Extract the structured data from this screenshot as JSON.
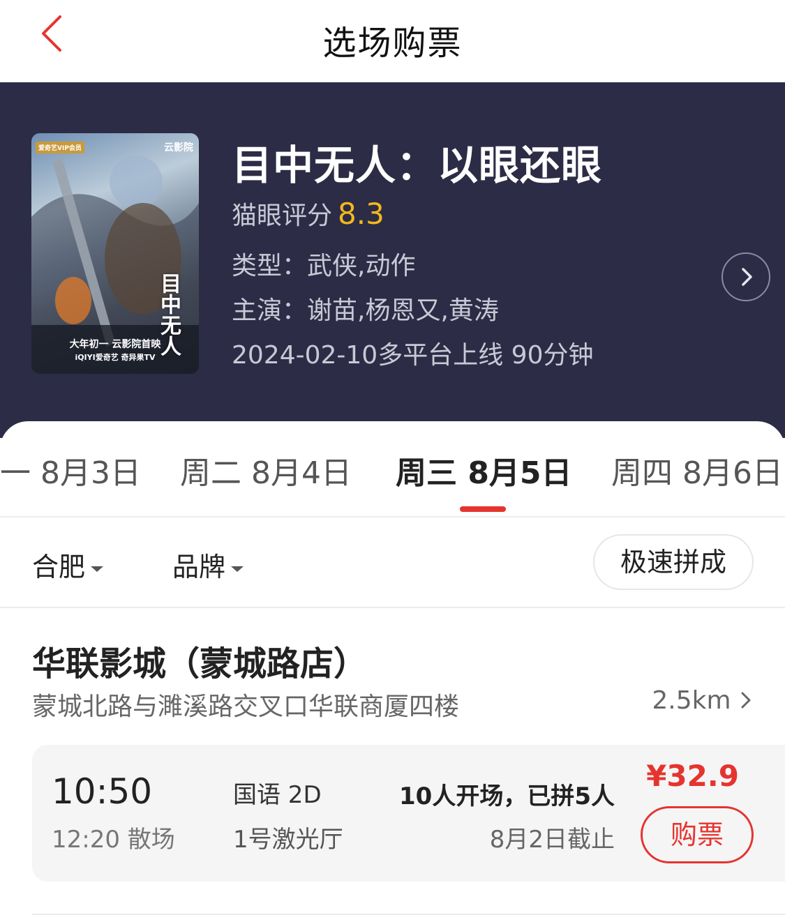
{
  "header": {
    "title": "选场购票"
  },
  "movie": {
    "title": "目中无人：以眼还眼",
    "score_label": "猫眼评分",
    "score": "8.3",
    "genre": "类型：武侠,动作",
    "cast": "主演：谢苗,杨恩又,黄涛",
    "release": "2024-02-10多平台上线 90分钟",
    "poster": {
      "badge": "爱奇艺VIP会员",
      "brand": "云影院",
      "vertical_title": "目中无人",
      "line1": "大年初一 云影院首映",
      "line2": "iQIYI爱奇艺  奇异果TV"
    }
  },
  "dates": [
    {
      "label": "一 8月3日"
    },
    {
      "label": "周二 8月4日"
    },
    {
      "label": "周三 8月5日",
      "active": true
    },
    {
      "label": "周四 8月6日"
    }
  ],
  "filters": {
    "city": "合肥",
    "brand": "品牌",
    "quick": "极速拼成"
  },
  "cinema": {
    "name": "华联影城（蒙城路店）",
    "address": "蒙城北路与濉溪路交叉口华联商厦四楼",
    "distance": "2.5km",
    "session": {
      "start": "10:50",
      "end": "12:20 散场",
      "language": "国语 2D",
      "hall": "1号激光厅",
      "group": "10人开场，已拼5人",
      "deadline": "8月2日截止",
      "price": "¥32.9",
      "buy": "购票"
    }
  },
  "colors": {
    "accent": "#e5342f",
    "banner": "#2c2c46",
    "score": "#f5b81c"
  }
}
